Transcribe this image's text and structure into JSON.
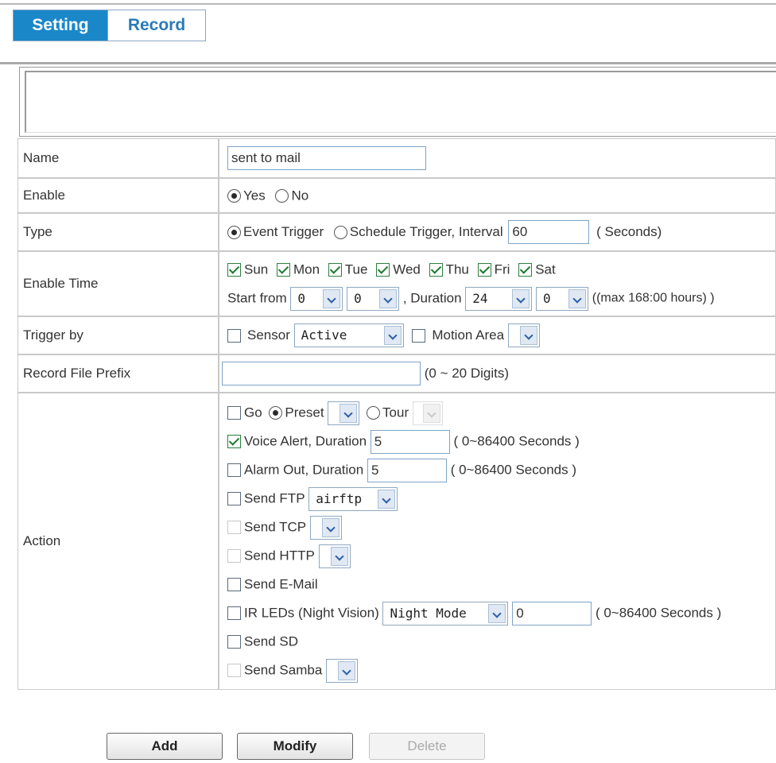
{
  "tabs": {
    "setting": "Setting",
    "record": "Record"
  },
  "form": {
    "name": {
      "label": "Name",
      "value": "sent to mail"
    },
    "enable": {
      "label": "Enable",
      "yes": "Yes",
      "no": "No"
    },
    "type": {
      "label": "Type",
      "event": "Event Trigger",
      "schedule": "Schedule Trigger, Interval",
      "interval": "60",
      "unit": "( Seconds)"
    },
    "enable_time": {
      "label": "Enable Time",
      "days": [
        "Sun",
        "Mon",
        "Tue",
        "Wed",
        "Thu",
        "Fri",
        "Sat"
      ],
      "start_label": "Start from",
      "start_hour": "0",
      "start_min": "0",
      "duration_label": ", Duration",
      "duration_hour": "24",
      "duration_min": "0",
      "max_note": "((max 168:00 hours) )"
    },
    "trigger": {
      "label": "Trigger by",
      "sensor": "Sensor",
      "sensor_value": "Active",
      "motion": "Motion Area"
    },
    "prefix": {
      "label": "Record File Prefix",
      "value": "",
      "note": "(0 ~ 20 Digits)"
    },
    "action": {
      "label": "Action",
      "go": "Go",
      "preset": "Preset",
      "tour": "Tour",
      "voice": "Voice Alert, Duration",
      "voice_value": "5",
      "voice_note": "( 0~86400 Seconds )",
      "alarm": "Alarm Out, Duration",
      "alarm_value": "5",
      "alarm_note": "( 0~86400 Seconds )",
      "ftp": "Send FTP",
      "ftp_value": "airftp",
      "tcp": "Send TCP",
      "http": "Send HTTP",
      "email": "Send E-Mail",
      "ir": "IR LEDs (Night Vision)",
      "ir_mode": "Night Mode",
      "ir_value": "0",
      "ir_note": "( 0~86400 Seconds )",
      "sd": "Send SD",
      "samba": "Send Samba"
    }
  },
  "buttons": {
    "add": "Add",
    "modify": "Modify",
    "delete": "Delete"
  }
}
